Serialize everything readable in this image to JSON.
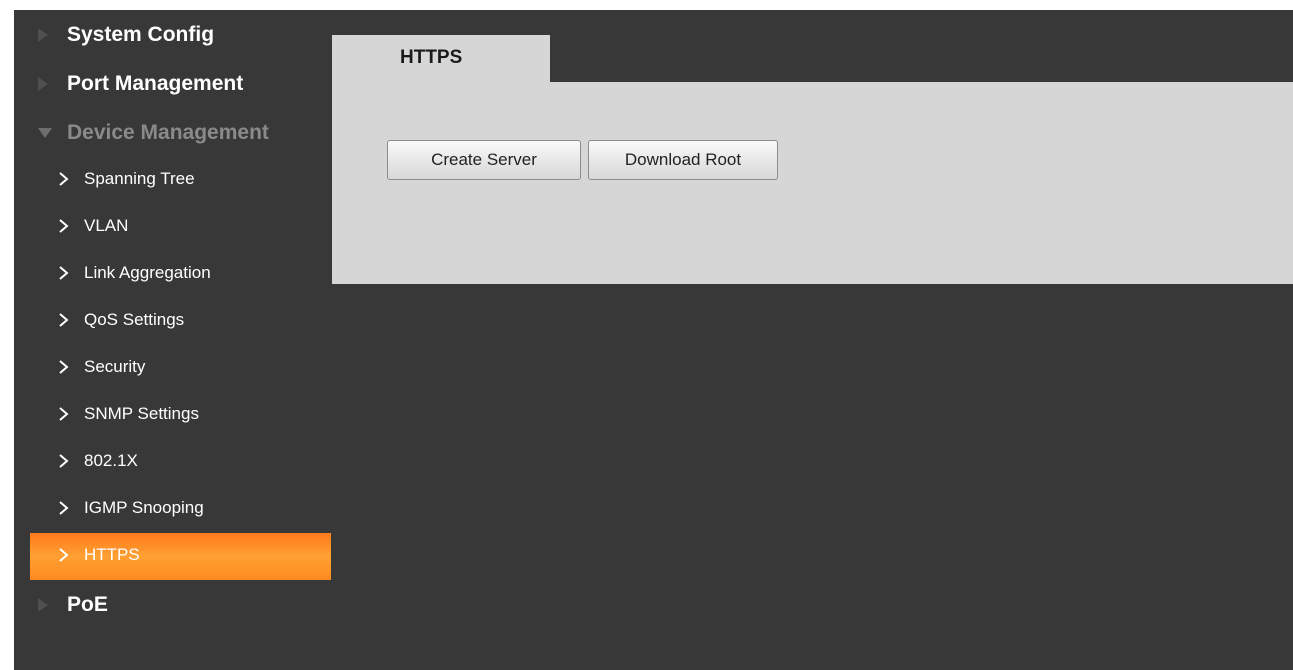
{
  "sidebar": {
    "sections": [
      {
        "label": "System Config",
        "state": "collapsed"
      },
      {
        "label": "Port Management",
        "state": "collapsed"
      },
      {
        "label": "Device Management",
        "state": "expanded"
      },
      {
        "label": "PoE",
        "state": "collapsed"
      }
    ],
    "device_management_items": [
      {
        "label": "Spanning Tree"
      },
      {
        "label": "VLAN"
      },
      {
        "label": "Link Aggregation"
      },
      {
        "label": "QoS Settings"
      },
      {
        "label": "Security"
      },
      {
        "label": "SNMP Settings"
      },
      {
        "label": "802.1X"
      },
      {
        "label": "IGMP Snooping"
      },
      {
        "label": "HTTPS",
        "active": true
      }
    ]
  },
  "main": {
    "tab_label": "HTTPS",
    "buttons": {
      "create_server": "Create Server",
      "download_root": "Download Root"
    }
  },
  "colors": {
    "background": "#383838",
    "panel": "#d6d6d6",
    "active_item": "#ff8c1a"
  },
  "icons": {
    "collapsed_section": "triangle-right-icon",
    "expanded_section": "triangle-down-icon",
    "sub_item": "chevron-right-icon"
  }
}
